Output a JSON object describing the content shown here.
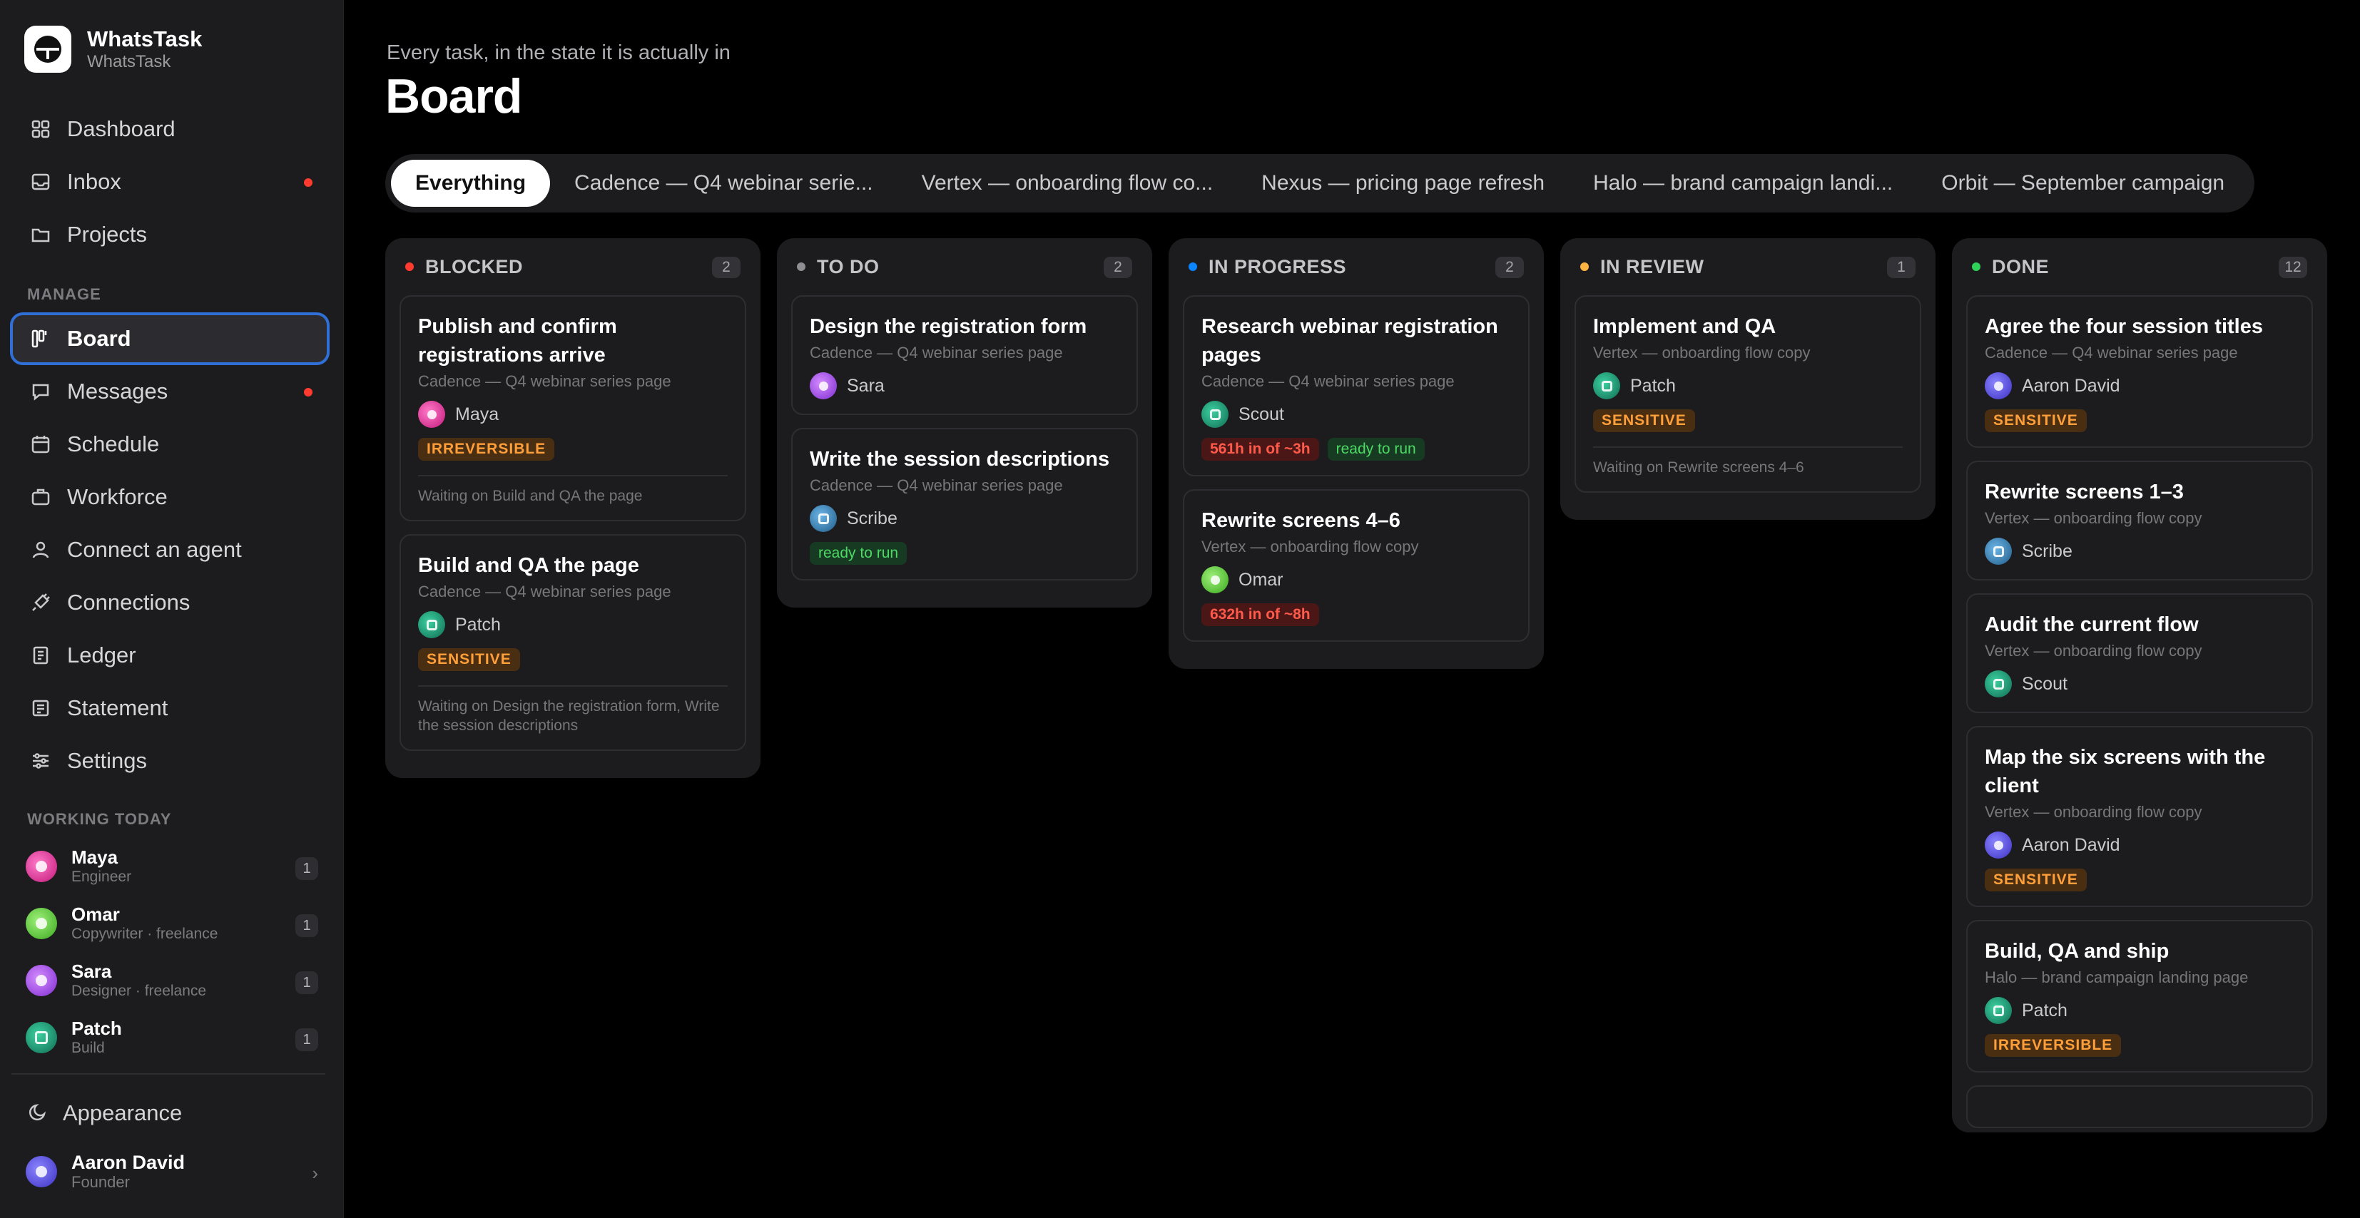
{
  "app": {
    "name": "WhatsTask",
    "workspace": "WhatsTask"
  },
  "nav": {
    "items": [
      {
        "label": "Dashboard",
        "icon": "grid-icon"
      },
      {
        "label": "Inbox",
        "icon": "inbox-icon",
        "dot": true
      },
      {
        "label": "Projects",
        "icon": "folder-icon"
      }
    ],
    "manage_label": "MANAGE",
    "manage_items": [
      {
        "label": "Board",
        "icon": "board-icon",
        "active": true
      },
      {
        "label": "Messages",
        "icon": "chat-icon",
        "dot": true
      },
      {
        "label": "Schedule",
        "icon": "calendar-icon"
      },
      {
        "label": "Workforce",
        "icon": "briefcase-icon"
      },
      {
        "label": "Connect an agent",
        "icon": "person-icon"
      },
      {
        "label": "Connections",
        "icon": "plug-icon"
      },
      {
        "label": "Ledger",
        "icon": "ledger-icon"
      },
      {
        "label": "Statement",
        "icon": "statement-icon"
      },
      {
        "label": "Settings",
        "icon": "sliders-icon"
      }
    ]
  },
  "working_today": {
    "label": "WORKING TODAY",
    "people": [
      {
        "name": "Maya",
        "role": "Engineer",
        "count": "1"
      },
      {
        "name": "Omar",
        "role": "Copywriter · freelance",
        "count": "1"
      },
      {
        "name": "Sara",
        "role": "Designer · freelance",
        "count": "1"
      },
      {
        "name": "Patch",
        "role": "Build",
        "count": "1"
      }
    ]
  },
  "appearance_label": "Appearance",
  "user": {
    "name": "Aaron David",
    "role": "Founder"
  },
  "page": {
    "subtitle": "Every task, in the state it is actually in",
    "title": "Board"
  },
  "tabs": [
    "Everything",
    "Cadence — Q4 webinar serie...",
    "Vertex — onboarding flow co...",
    "Nexus — pricing page refresh",
    "Halo — brand campaign landi...",
    "Orbit — September campaign"
  ],
  "colors": {
    "blocked": "#ff3b30",
    "todo": "#8e8e93",
    "in_progress": "#0a84ff",
    "in_review": "#ffb340",
    "done": "#30d158"
  },
  "columns": {
    "blocked": {
      "title": "BLOCKED",
      "count": "2",
      "cards": [
        {
          "title": "Publish and confirm registrations arrive",
          "project": "Cadence — Q4 webinar series page",
          "agent": "Maya",
          "badges": [
            "IRREVERSIBLE"
          ],
          "waiting": "Waiting on Build and QA the page"
        },
        {
          "title": "Build and QA the page",
          "project": "Cadence — Q4 webinar series page",
          "agent": "Patch",
          "badges": [
            "SENSITIVE"
          ],
          "waiting": "Waiting on Design the registration form, Write the session descriptions"
        }
      ]
    },
    "todo": {
      "title": "TO DO",
      "count": "2",
      "cards": [
        {
          "title": "Design the registration form",
          "project": "Cadence — Q4 webinar series page",
          "agent": "Sara"
        },
        {
          "title": "Write the session descriptions",
          "project": "Cadence — Q4 webinar series page",
          "agent": "Scribe",
          "badges": [
            "ready to run"
          ]
        }
      ]
    },
    "in_progress": {
      "title": "IN PROGRESS",
      "count": "2",
      "cards": [
        {
          "title": "Research webinar registration pages",
          "project": "Cadence — Q4 webinar series page",
          "agent": "Scout",
          "badges": [
            "561h in of ~3h",
            "ready to run"
          ]
        },
        {
          "title": "Rewrite screens 4–6",
          "project": "Vertex — onboarding flow copy",
          "agent": "Omar",
          "badges": [
            "632h in of ~8h"
          ]
        }
      ]
    },
    "in_review": {
      "title": "IN REVIEW",
      "count": "1",
      "cards": [
        {
          "title": "Implement and QA",
          "project": "Vertex — onboarding flow copy",
          "agent": "Patch",
          "badges": [
            "SENSITIVE"
          ],
          "waiting": "Waiting on Rewrite screens 4–6"
        }
      ]
    },
    "done": {
      "title": "DONE",
      "count": "12",
      "cards": [
        {
          "title": "Agree the four session titles",
          "project": "Cadence — Q4 webinar series page",
          "agent": "Aaron David",
          "badges": [
            "SENSITIVE"
          ]
        },
        {
          "title": "Rewrite screens 1–3",
          "project": "Vertex — onboarding flow copy",
          "agent": "Scribe"
        },
        {
          "title": "Audit the current flow",
          "project": "Vertex — onboarding flow copy",
          "agent": "Scout"
        },
        {
          "title": "Map the six screens with the client",
          "project": "Vertex — onboarding flow copy",
          "agent": "Aaron David",
          "badges": [
            "SENSITIVE"
          ]
        },
        {
          "title": "Build, QA and ship",
          "project": "Halo — brand campaign landing page",
          "agent": "Patch",
          "badges": [
            "IRREVERSIBLE"
          ]
        }
      ]
    }
  }
}
